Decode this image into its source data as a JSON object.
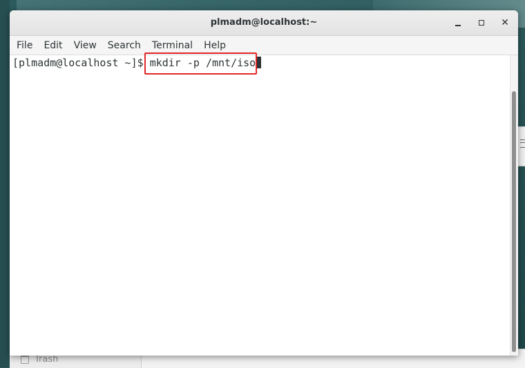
{
  "window": {
    "title": "plmadm@localhost:~"
  },
  "menu": [
    "File",
    "Edit",
    "View",
    "Search",
    "Terminal",
    "Help"
  ],
  "terminal": {
    "prompt": "[plmadm@localhost ~]$ ",
    "command": "mkdir -p /mnt/iso"
  },
  "desktop": {
    "trash_label": "Trash"
  },
  "colors": {
    "highlight": "#e22525",
    "text": "#2e3436"
  },
  "icons": {
    "minimize": "minimize-icon",
    "maximize": "maximize-icon",
    "close": "close-icon",
    "trash": "trash-icon"
  }
}
